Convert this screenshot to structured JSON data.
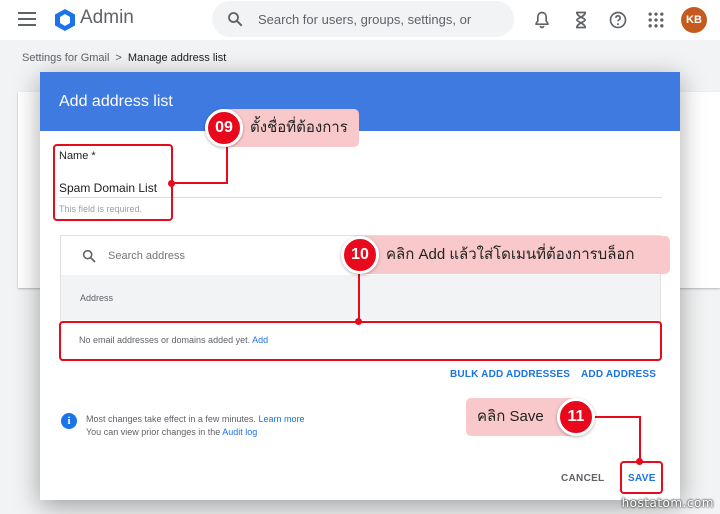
{
  "topbar": {
    "app_name": "Admin",
    "search_placeholder": "Search for users, groups, settings, or o",
    "avatar_initials": "KB"
  },
  "breadcrumb": {
    "parent": "Settings for Gmail",
    "separator": ">",
    "current": "Manage address list"
  },
  "dialog": {
    "title": "Add address list",
    "name_label": "Name *",
    "name_value": "Spam Domain List",
    "name_helper": "This field is required.",
    "address_search_placeholder": "Search address",
    "address_column": "Address",
    "empty_text": "No email addresses or domains added yet.",
    "empty_add_link": "Add",
    "bulk_add": "BULK ADD ADDRESSES",
    "add_address": "ADD ADDRESS",
    "info_line1": "Most changes take effect in a few minutes.",
    "learn_more": "Learn more",
    "info_line2": "You can view prior changes in the",
    "audit_log": "Audit log",
    "cancel": "CANCEL",
    "save": "SAVE"
  },
  "annotations": [
    {
      "number": "09",
      "text": "ตั้งชื่อที่ต้องการ"
    },
    {
      "number": "10",
      "text": "คลิก Add แล้วใส่โดเมนที่ต้องการบล็อก"
    },
    {
      "number": "11",
      "text": "คลิก Save"
    }
  ],
  "colors": {
    "header_blue": "#3f7ae0",
    "link_blue": "#1a73e8",
    "annotation_red": "#e8091c",
    "callout_pink": "#f9c8cb"
  },
  "watermark": "hostatom.com"
}
